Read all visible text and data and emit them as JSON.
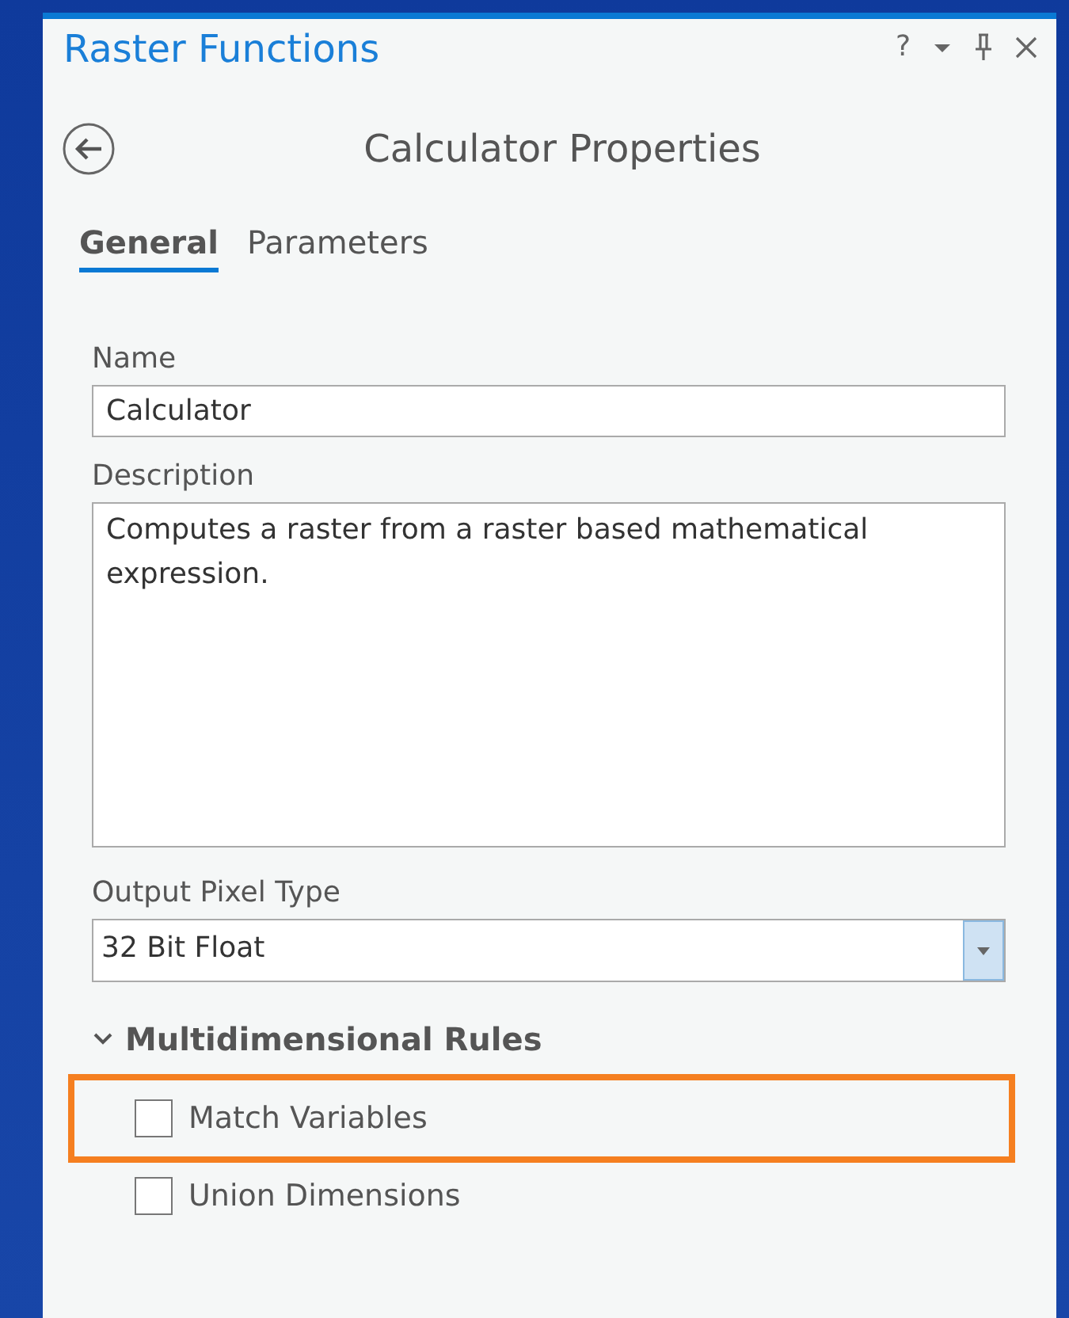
{
  "pane": {
    "title": "Raster Functions",
    "help": "?"
  },
  "heading": "Calculator Properties",
  "tabs": [
    {
      "label": "General",
      "selected": true
    },
    {
      "label": "Parameters",
      "selected": false
    }
  ],
  "fields": [
    {
      "kind": "text",
      "label": "Name",
      "value": "Calculator"
    },
    {
      "kind": "textarea",
      "label": "Description",
      "value": "Computes a raster from a raster based mathematical expression."
    },
    {
      "kind": "dropdown",
      "label": "Output Pixel Type",
      "value": "32 Bit Float"
    }
  ],
  "section": {
    "title": "Multidimensional Rules",
    "expanded": true,
    "options": [
      {
        "label": "Match Variables",
        "checked": false,
        "highlighted": true
      },
      {
        "label": "Union Dimensions",
        "checked": false,
        "highlighted": false
      }
    ]
  }
}
